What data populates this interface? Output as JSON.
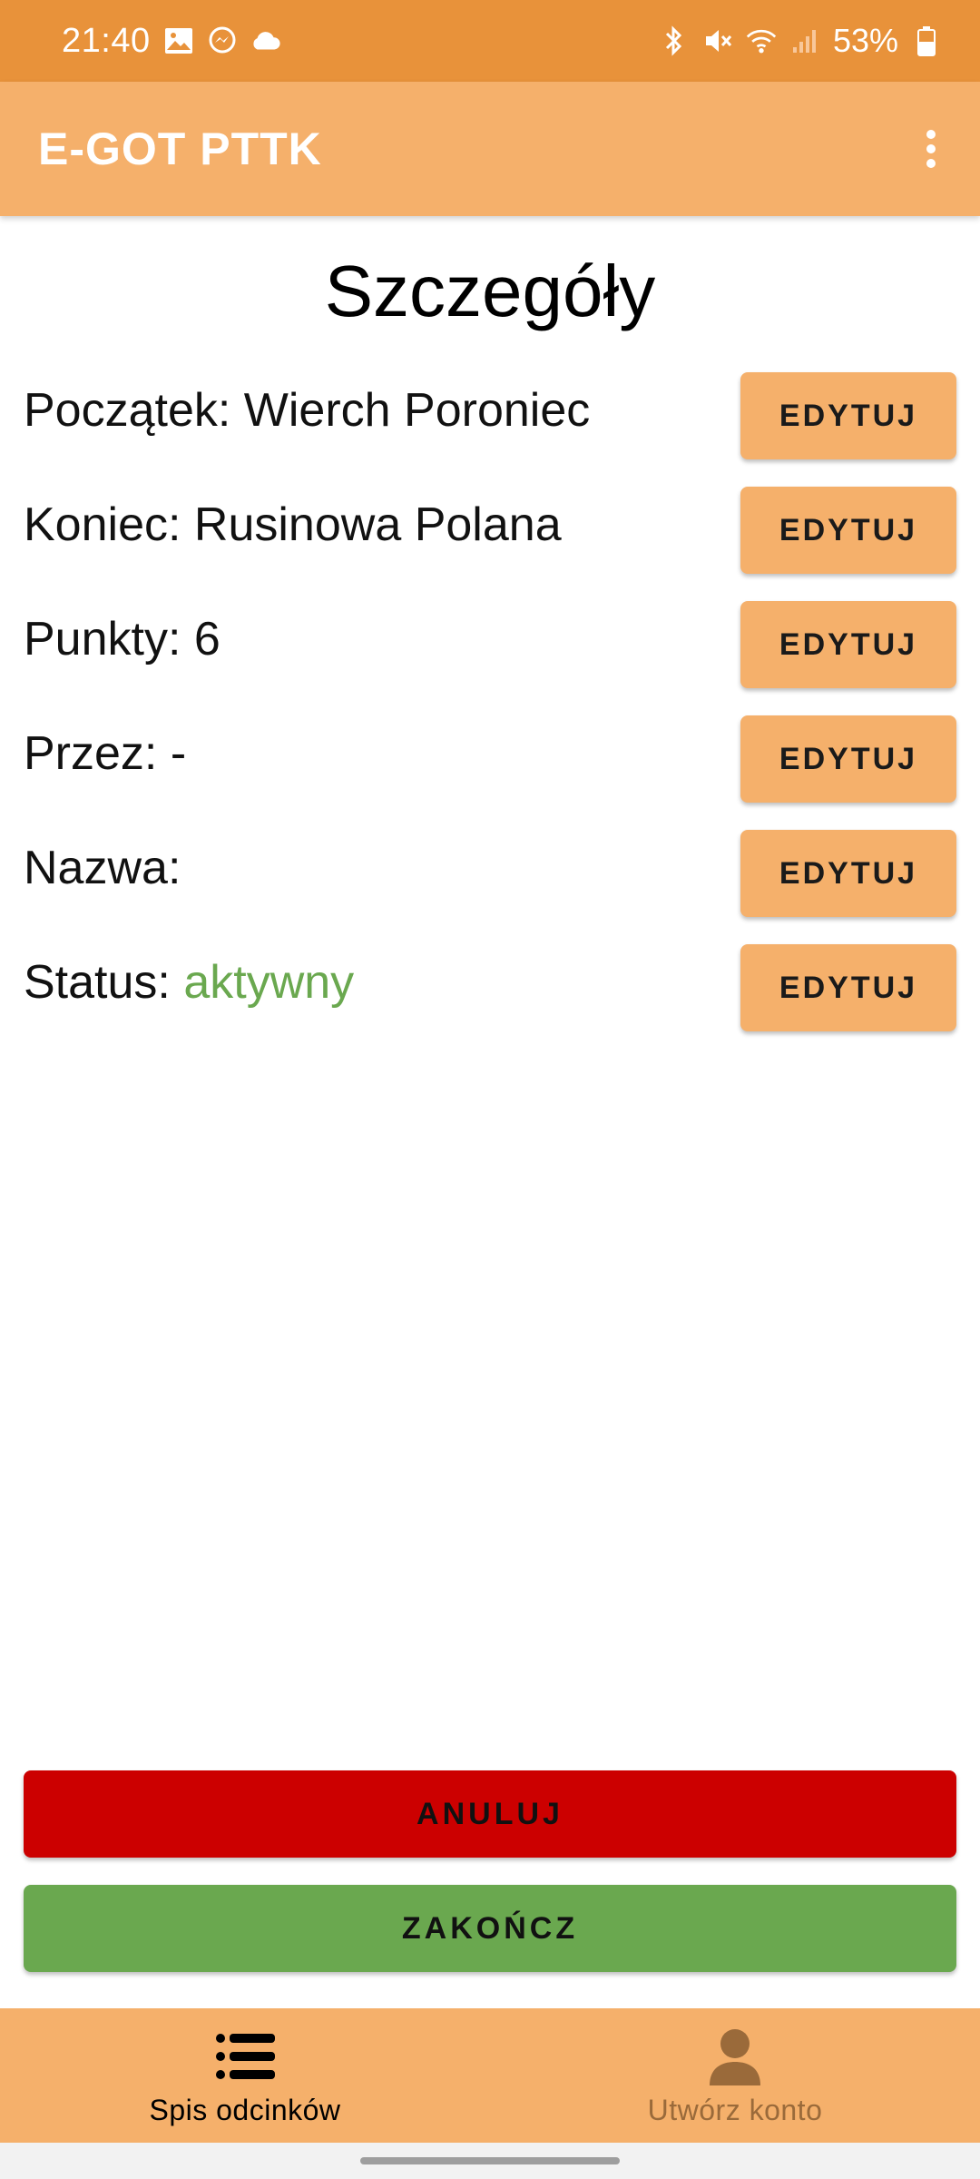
{
  "status_bar": {
    "time": "21:40",
    "battery": "53%",
    "left_icons": [
      "image-icon",
      "messenger-icon",
      "cloud-icon"
    ],
    "right_icons": [
      "bluetooth-icon",
      "mute-icon",
      "wifi-icon",
      "signal-icon",
      "battery-icon"
    ]
  },
  "app_bar": {
    "title": "E-GOT PTTK",
    "menu_icon": "more-vert-icon"
  },
  "page": {
    "title": "Szczegóły"
  },
  "details": [
    {
      "label": "Początek:",
      "value": "Wierch Poroniec",
      "button": "EDYTUJ"
    },
    {
      "label": "Koniec:",
      "value": "Rusinowa Polana",
      "button": "EDYTUJ"
    },
    {
      "label": "Punkty:",
      "value": "6",
      "button": "EDYTUJ"
    },
    {
      "label": "Przez:",
      "value": "-",
      "button": "EDYTUJ"
    },
    {
      "label": "Nazwa:",
      "value": "",
      "button": "EDYTUJ"
    },
    {
      "label": "Status:",
      "value": "aktywny",
      "button": "EDYTUJ"
    }
  ],
  "actions": {
    "cancel_label": "ANULUJ",
    "finish_label": "ZAKOŃCZ"
  },
  "bottom_nav": {
    "items": [
      {
        "label": "Spis odcinków",
        "icon": "list-icon",
        "active": true
      },
      {
        "label": "Utwórz konto",
        "icon": "person-icon",
        "active": false
      }
    ]
  },
  "colors": {
    "status_bar": "#e8923a",
    "accent": "#f5b06b",
    "cancel": "#cc0000",
    "finish": "#6aa84f",
    "status_active_text": "#6aa84f"
  }
}
